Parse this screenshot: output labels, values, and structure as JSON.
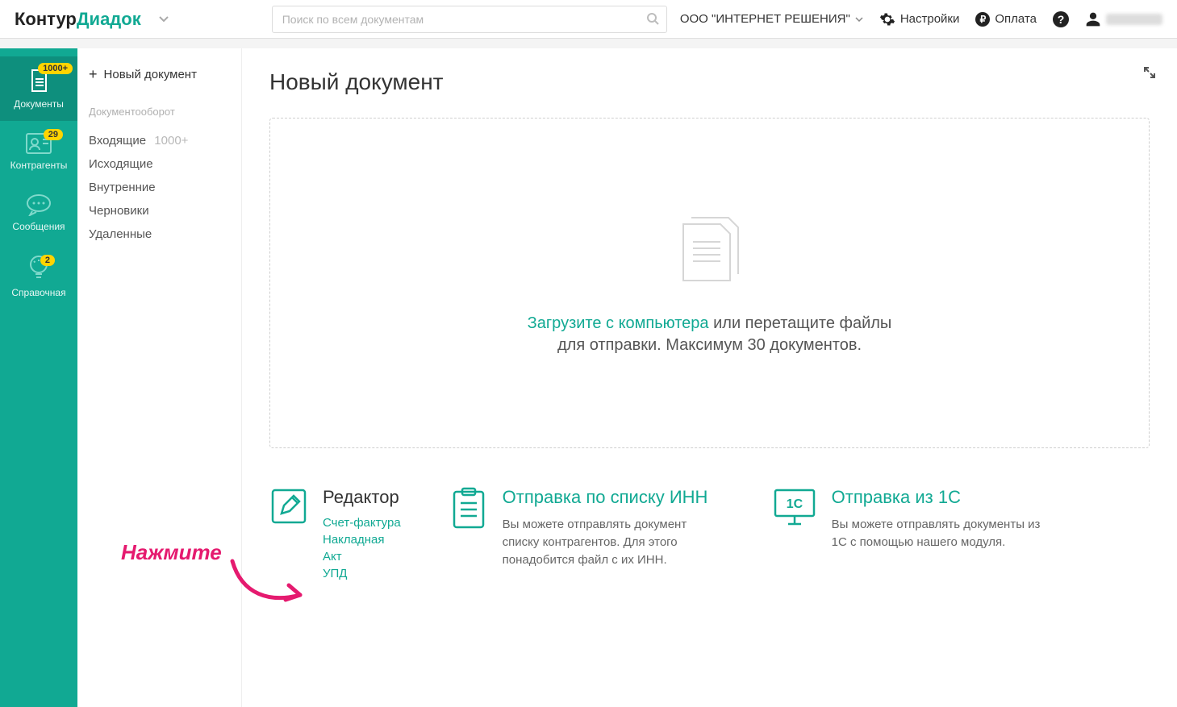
{
  "brand": {
    "part1": "Контур",
    "part2": "Диадок"
  },
  "search": {
    "placeholder": "Поиск по всем документам"
  },
  "org_name": "ООО \"ИНТЕРНЕТ РЕШЕНИЯ\"",
  "topnav": {
    "settings": "Настройки",
    "payment": "Оплата"
  },
  "rail": {
    "docs": {
      "label": "Документы",
      "badge": "1000+"
    },
    "contr": {
      "label": "Контрагенты",
      "badge": "29"
    },
    "msg": {
      "label": "Сообщения"
    },
    "help": {
      "label": "Справочная",
      "badge": "2"
    }
  },
  "subnav": {
    "new_doc": "Новый документ",
    "group": "Документооборот",
    "inbox": {
      "label": "Входящие",
      "count": "1000+"
    },
    "outbox": "Исходящие",
    "internal": "Внутренние",
    "drafts": "Черновики",
    "deleted": "Удаленные"
  },
  "main": {
    "title": "Новый документ",
    "dropzone": {
      "link": "Загрузите с компьютера",
      "rest1": " или перетащите файлы",
      "line2": "для отправки. Максимум 30 документов."
    }
  },
  "editor": {
    "title": "Редактор",
    "links": {
      "invoice": "Счет-фактура",
      "waybill": "Накладная",
      "act": "Акт",
      "upd": "УПД"
    }
  },
  "inn_send": {
    "title": "Отправка по списку ИНН",
    "desc": "Вы можете отправлять документ списку контрагентов. Для этого понадобится файл с их ИНН."
  },
  "onec_send": {
    "title": "Отправка из 1С",
    "desc": "Вы можете отправлять документы из 1С с помощью нашего модуля."
  },
  "annotation": {
    "label": "Нажмите"
  },
  "icons": {
    "onec_label": "1C",
    "ruble": "₽",
    "help_q": "?"
  }
}
